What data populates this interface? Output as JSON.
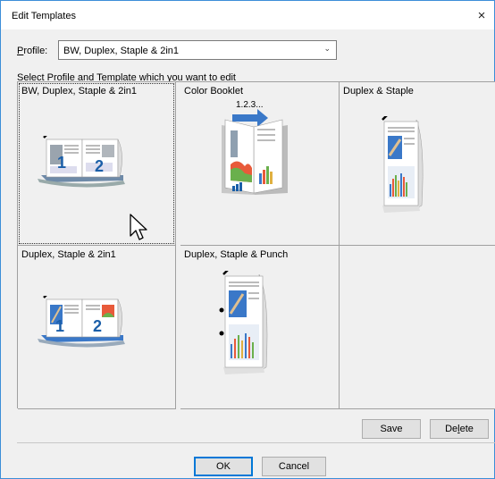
{
  "window": {
    "title": "Edit Templates",
    "close_glyph": "×"
  },
  "profile": {
    "label": "Profile:",
    "label_underlined": "P",
    "label_rest": "rofile:",
    "selected": "BW, Duplex, Staple & 2in1"
  },
  "instruction": "Select Profile and Template which you want to edit",
  "templates": [
    {
      "label": "BW, Duplex, Staple & 2in1",
      "icon": "duplex-2in1-bw-icon",
      "selected": true
    },
    {
      "label": "Color Booklet",
      "icon": "booklet-icon",
      "overlay": "1.2.3..."
    },
    {
      "label": "Duplex & Staple",
      "icon": "duplex-staple-icon"
    },
    {
      "label": "Duplex, Staple & 2in1",
      "icon": "duplex-2in1-color-icon"
    },
    {
      "label": "Duplex, Staple & Punch",
      "icon": "duplex-staple-punch-icon"
    },
    {
      "label": "",
      "icon": ""
    }
  ],
  "buttons": {
    "save": "Save",
    "delete_pre": "De",
    "delete_u": "l",
    "delete_post": "ete",
    "ok": "OK",
    "cancel": "Cancel"
  },
  "colors": {
    "accent": "#0078d7",
    "window_border": "#3c8ed8",
    "arrow": "#3a78c8"
  }
}
